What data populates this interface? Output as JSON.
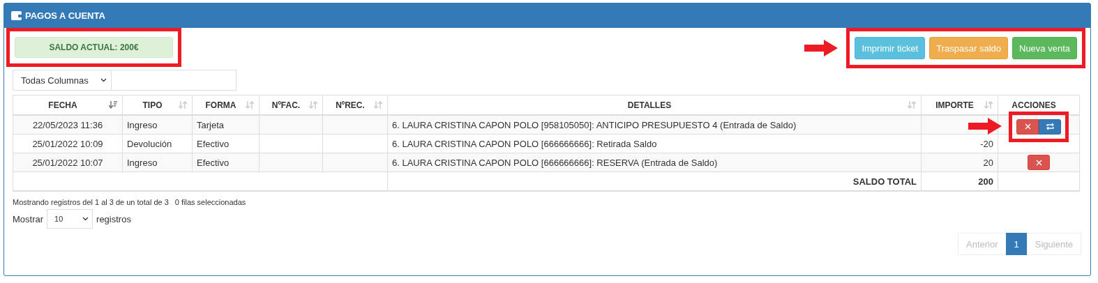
{
  "panel": {
    "title": "PAGOS A CUENTA"
  },
  "balance": {
    "text": "SALDO ACTUAL: 200€",
    "highlighted": true
  },
  "toolbar": {
    "highlighted": true,
    "arrow": true,
    "buttons": [
      {
        "label": "Imprimir ticket",
        "kind": "info"
      },
      {
        "label": "Traspasar saldo",
        "kind": "warning"
      },
      {
        "label": "Nueva venta",
        "kind": "success"
      }
    ]
  },
  "filter": {
    "column_select": "Todas Columnas"
  },
  "table": {
    "columns": [
      {
        "label": "FECHA",
        "kind": "sorted"
      },
      {
        "label": "TIPO",
        "kind": "sortable"
      },
      {
        "label": "FORMA",
        "kind": "sortable"
      },
      {
        "label": "NºFAC.",
        "kind": "sortable"
      },
      {
        "label": "NºREC.",
        "kind": "sortable"
      },
      {
        "label": "DETALLES",
        "kind": "sortable"
      },
      {
        "label": "IMPORTE",
        "kind": "sortable"
      },
      {
        "label": "ACCIONES",
        "kind": "plain"
      }
    ],
    "rows": [
      {
        "fecha": "22/05/2023 11:36",
        "tipo": "Ingreso",
        "forma": "Tarjeta",
        "detalles": "6. LAURA CRISTINA CAPON POLO [958105050]: ANTICIPO PRESUPUESTO 4 (Entrada de Saldo)",
        "actions": [
          {
            "kind": "delete"
          },
          {
            "kind": "transfer"
          }
        ],
        "highlighted": true,
        "arrow": true
      },
      {
        "fecha": "25/01/2022 10:09",
        "tipo": "Devolución",
        "forma": "Efectivo",
        "detalles": "6. LAURA CRISTINA CAPON POLO [666666666]: Retirada Saldo",
        "importe": "-20",
        "actions": [],
        "highlighted": false,
        "arrow": false
      },
      {
        "fecha": "25/01/2022 10:07",
        "tipo": "Ingreso",
        "forma": "Efectivo",
        "detalles": "6. LAURA CRISTINA CAPON POLO [666666666]: RESERVA (Entrada de Saldo)",
        "importe": "20",
        "actions": [
          {
            "kind": "delete"
          }
        ],
        "highlighted": false,
        "arrow": false
      }
    ],
    "total": {
      "label": "SALDO TOTAL",
      "value": "200"
    }
  },
  "info": {
    "records": "Mostrando registros del 1 al 3 de un total de 3",
    "selected": "0 filas seleccionadas"
  },
  "length": {
    "before": "Mostrar",
    "value": "10",
    "after": "registros"
  },
  "pagination": [
    {
      "label": "Anterior",
      "selected": false,
      "disabled": true
    },
    {
      "label": "1",
      "selected": true,
      "disabled": false
    },
    {
      "label": "Siguiente",
      "selected": false,
      "disabled": true
    }
  ]
}
